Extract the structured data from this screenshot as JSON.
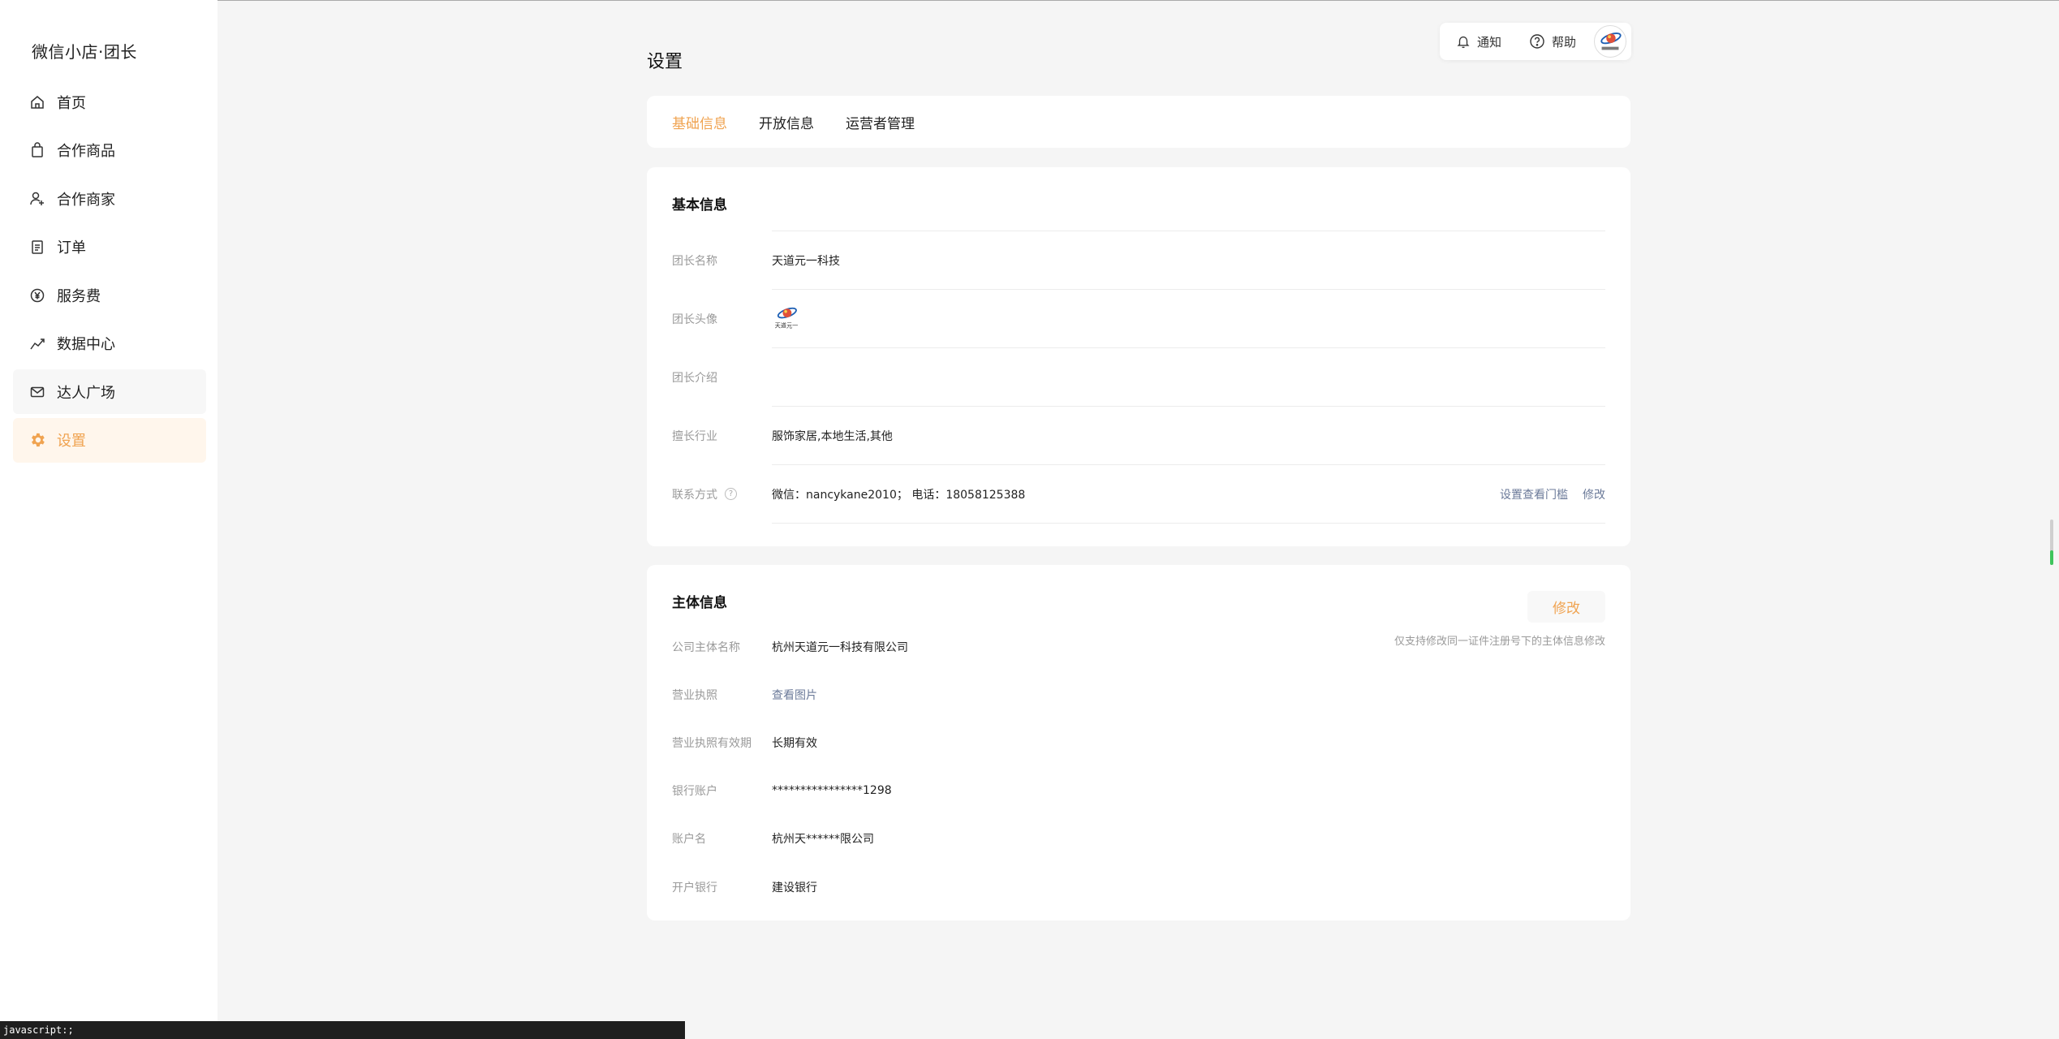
{
  "app": {
    "brand": "微信小店·团长"
  },
  "sidebar": {
    "items": [
      {
        "label": "首页",
        "icon": "home-icon"
      },
      {
        "label": "合作商品",
        "icon": "shopping-bag-icon"
      },
      {
        "label": "合作商家",
        "icon": "user-add-icon"
      },
      {
        "label": "订单",
        "icon": "clipboard-icon"
      },
      {
        "label": "服务费",
        "icon": "yen-coin-icon"
      },
      {
        "label": "数据中心",
        "icon": "trend-chart-icon"
      },
      {
        "label": "达人广场",
        "icon": "mail-icon"
      },
      {
        "label": "设置",
        "icon": "gear-icon"
      }
    ],
    "active_index": 7,
    "hover_index": 6
  },
  "topbar": {
    "notify": "通知",
    "help": "帮助"
  },
  "page": {
    "title": "设置"
  },
  "tabs": [
    {
      "label": "基础信息",
      "active": true
    },
    {
      "label": "开放信息",
      "active": false
    },
    {
      "label": "运营者管理",
      "active": false
    }
  ],
  "basic": {
    "title": "基本信息",
    "rows": [
      {
        "label": "团长名称",
        "value": "天道元一科技"
      },
      {
        "label": "团长头像",
        "value": ""
      },
      {
        "label": "团长介绍",
        "value": ""
      },
      {
        "label": "擅长行业",
        "value": "服饰家居,本地生活,其他"
      },
      {
        "label": "联系方式",
        "value": "微信：nancykane2010； 电话：18058125388"
      }
    ],
    "contact_actions": {
      "threshold": "设置查看门槛",
      "edit": "修改"
    },
    "avatar_caption": "天道元一"
  },
  "subject": {
    "title": "主体信息",
    "edit": "修改",
    "note": "仅支持修改同一证件注册号下的主体信息修改",
    "rows": [
      {
        "label": "公司主体名称",
        "value": "杭州天道元一科技有限公司"
      },
      {
        "label": "营业执照",
        "value": "查看图片"
      },
      {
        "label": "营业执照有效期",
        "value": "长期有效"
      },
      {
        "label": "银行账户",
        "value": "****************1298"
      },
      {
        "label": "账户名",
        "value": "杭州天******限公司"
      },
      {
        "label": "开户银行",
        "value": "建设银行"
      }
    ]
  },
  "statusbar": {
    "text": "javascript:;"
  },
  "colors": {
    "accent": "#f0a350",
    "link": "#6b7a99",
    "muted": "#9a9a9a"
  }
}
